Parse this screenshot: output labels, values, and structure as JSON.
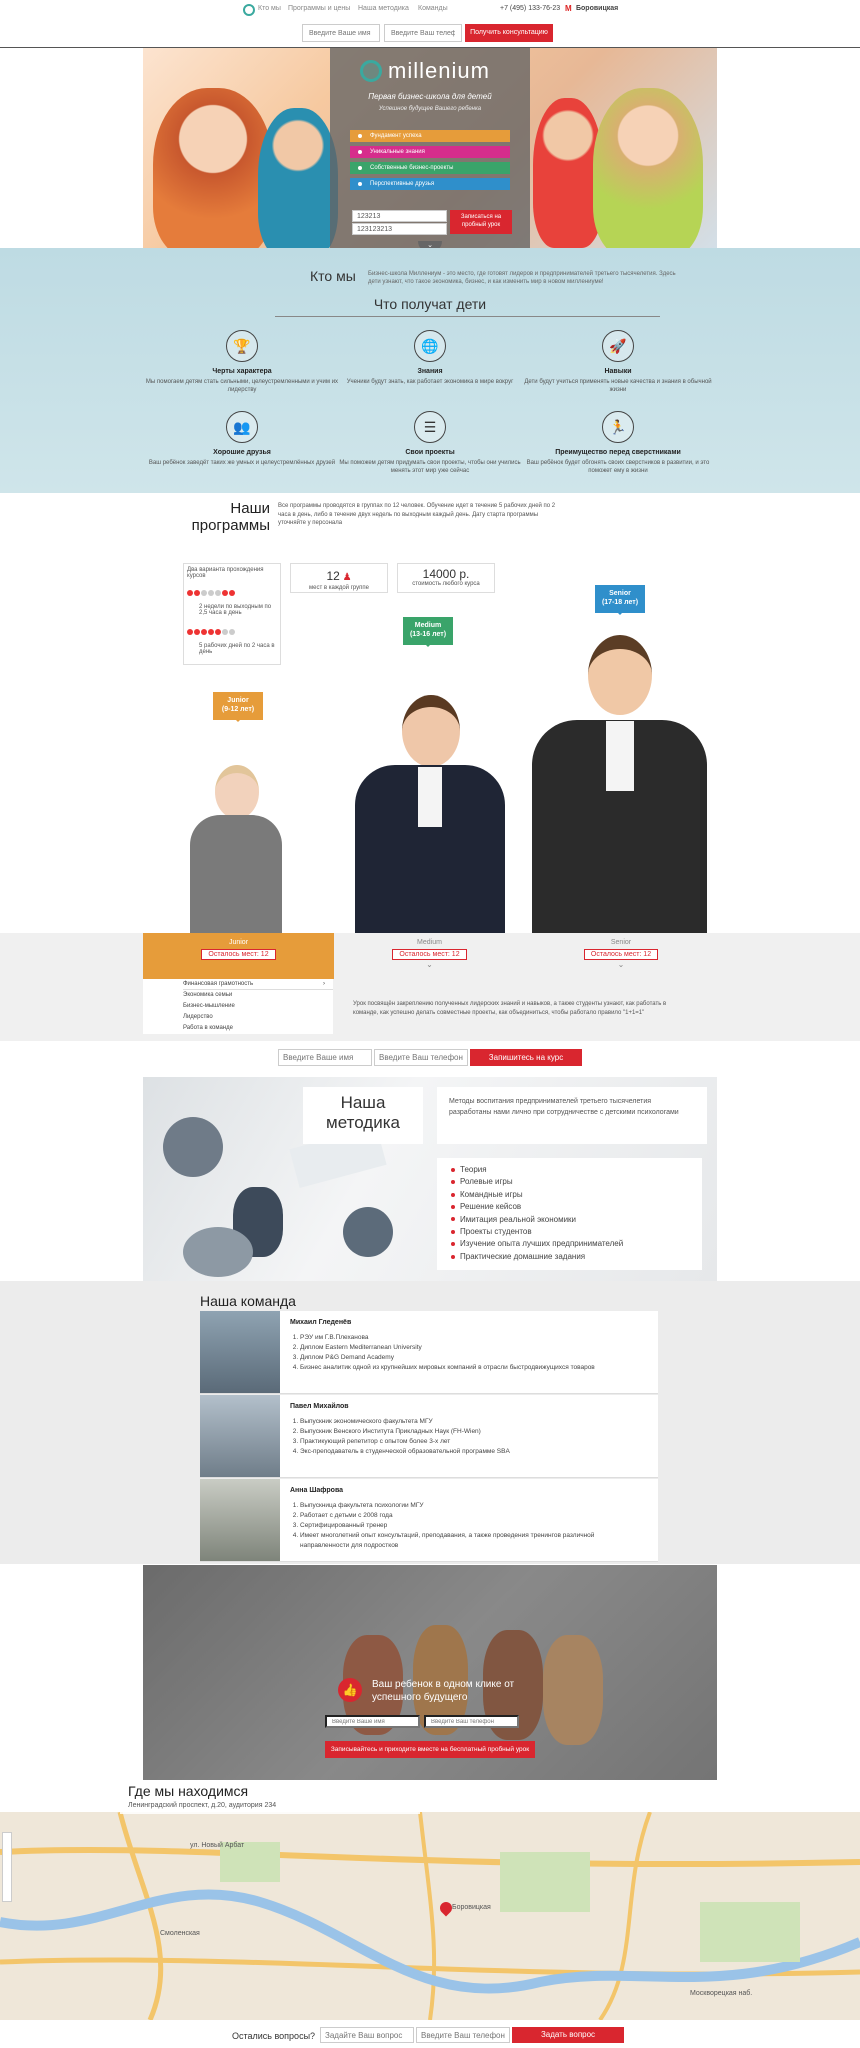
{
  "nav": {
    "links": [
      "Кто мы",
      "Программы и цены",
      "Наша методика",
      "Команды"
    ],
    "phone": "+7 (495) 133-76-23",
    "metro_icon": "metro-icon",
    "metro": "Боровицкая",
    "name_placeholder": "Введите Ваше имя",
    "phone_placeholder": "Введите Ваш телефон",
    "cta": "Получить консультацию"
  },
  "hero": {
    "brand": "millenium",
    "tagline": "Первая бизнес-школа для детей",
    "subtag": "Успешное будущее Вашего ребенка",
    "pills": [
      {
        "label": "Фундамент успеха",
        "color": "#e69c3a"
      },
      {
        "label": "Уникальные знания",
        "color": "#d62d8c"
      },
      {
        "label": "Собственные бизнес-проекты",
        "color": "#3aa46a"
      },
      {
        "label": "Перспективные друзья",
        "color": "#2f8fcb"
      }
    ],
    "name_value": "123213",
    "phone_value": "123123213",
    "button": "Записаться на пробный урок"
  },
  "who": {
    "title": "Кто мы",
    "text": "Бизнес-школа Миллениум - это место, где готовят лидеров и предпринимателей третьего тысячелетия. Здесь дети узнают, что такое экономика, бизнес, и как изменить мир в новом миллениуме!",
    "get_title": "Что получат дети",
    "features": [
      {
        "icon": "trophy-icon",
        "glyph": "🏆",
        "title": "Черты характера",
        "text": "Мы помогаем детям стать сильными, целеустремленными и учим их лидерству"
      },
      {
        "icon": "globe-icon",
        "glyph": "🌐",
        "title": "Знания",
        "text": "Ученики будут знать, как работает экономика в мире вокруг"
      },
      {
        "icon": "rocket-icon",
        "glyph": "🚀",
        "title": "Навыки",
        "text": "Дети будут учиться применять новые качества и знания в обычной жизни"
      },
      {
        "icon": "people-icon",
        "glyph": "👥",
        "title": "Хорошие друзья",
        "text": "Ваш ребёнок заведёт таких же умных и целеустремлённых друзей"
      },
      {
        "icon": "projects-icon",
        "glyph": "☰",
        "title": "Свои проекты",
        "text": "Мы поможем детям придумать свои проекты, чтобы они учились менять этот мир уже сейчас"
      },
      {
        "icon": "runner-icon",
        "glyph": "🏃",
        "title": "Преимущество перед сверстниками",
        "text": "Ваш ребёнок будет обгонять своих сверстников в развитии, и это поможет ему в жизни"
      }
    ]
  },
  "programs": {
    "title_line1": "Наши",
    "title_line2": "программы",
    "text": "Все программы проводятся в группах по 12 человек. Обучение идет в течение 5 рабочих дней по 2 часа в день, либо в течение двух недель по выходным каждый день. Дату старта программы уточняйте у персонала",
    "variants_title": "Два варианта прохождения курсов",
    "variant1": "2 недели по выходным по 2,5 часа в день",
    "variant2": "5 рабочих дней по 2 часа в день",
    "seats_num": "12",
    "seats_label": "мест в каждой группе",
    "price": "14000 р.",
    "price_label": "стоимость любого курса",
    "flags": [
      {
        "name": "Junior",
        "ages": "(9-12 лет)",
        "color": "#e69c3a"
      },
      {
        "name": "Medium",
        "ages": "(13-16 лет)",
        "color": "#3aa46a"
      },
      {
        "name": "Senior",
        "ages": "(17-18 лет)",
        "color": "#2f8fcb"
      }
    ],
    "tabs": [
      {
        "name": "Junior",
        "badge": "Осталось мест: 12"
      },
      {
        "name": "Medium",
        "badge": "Осталось мест: 12"
      },
      {
        "name": "Senior",
        "badge": "Осталось мест: 12"
      }
    ],
    "junior_list": [
      "Финансовая грамотность",
      "Экономика семьи",
      "Бизнес-мышление",
      "Лидерство",
      "Работа в команде"
    ],
    "junior_text": "Урок посвящён закреплению полученных лидерских знаний и навыков, а также студенты узнают, как работать в команде, как успешно делать совместные проекты, как объединиться, чтобы работало правило \"1+1=1\""
  },
  "signup": {
    "name_placeholder": "Введите Ваше имя",
    "phone_placeholder": "Введите Ваш телефон",
    "button": "Запишитесь на курс"
  },
  "method": {
    "title_line1": "Наша",
    "title_line2": "методика",
    "text": "Методы воспитания предпринимателей третьего тысячелетия разработаны нами лично при сотрудничестве с детскими психологами",
    "items": [
      "Теория",
      "Ролевые игры",
      "Командные игры",
      "Решение кейсов",
      "Имитация реальной экономики",
      "Проекты студентов",
      "Изучение опыта лучших предпринимателей",
      "Практические домашние задания"
    ]
  },
  "team": {
    "title": "Наша команда",
    "members": [
      {
        "name": "Михаил Гледенёв",
        "items": [
          "РЭУ им Г.В.Плеханова",
          "Диплом Eastern Mediterranean University",
          "Диплом P&G Demand Academy",
          "Бизнес аналитик одной из крупнейших мировых компаний в отрасли быстродвижущихся товаров"
        ]
      },
      {
        "name": "Павел Михайлов",
        "items": [
          "Выпускник экономического факультета МГУ",
          "Выпускник Венского Института Прикладных Наук (FH-Wien)",
          "Практикующий репетитор с опытом более 3-х лет",
          "Экс-преподаватель в студенческой образовательной программе SBA"
        ]
      },
      {
        "name": "Анна Шафрова",
        "items": [
          "Выпускница факультета психологии МГУ",
          "Работает с детьми с 2008 года",
          "Сертифицированный тренер",
          "Имеет многолетний опыт консультаций, преподавания, а также проведения тренингов различной направленности для подростков"
        ]
      }
    ]
  },
  "cta": {
    "title": "Ваш ребенок в одном клике от успешного будущего",
    "name_placeholder": "Введите Ваше имя",
    "phone_placeholder": "Введите Ваш телефон",
    "button": "Записывайтесь и приходите вместе на бесплатный пробный урок"
  },
  "map": {
    "title": "Где мы находимся",
    "address": "Ленинградский проспект, д.20, аудитория 234",
    "streets": [
      "ул. Новый Арбат",
      "Москворецкая наб.",
      "Боровицкая",
      "Смоленская"
    ]
  },
  "footer": {
    "question": "Остались вопросы?",
    "name_placeholder": "Задайте Ваш вопрос",
    "phone_placeholder": "Введите Ваш телефон",
    "button": "Задать вопрос"
  }
}
